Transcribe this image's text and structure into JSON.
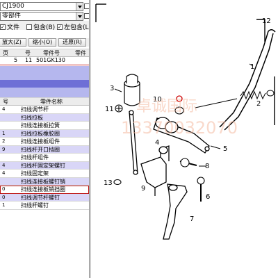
{
  "selectors": {
    "model_value": "CJ1900",
    "component_value": "零部件"
  },
  "options": {
    "opt1_label": "文件",
    "opt2_label": "包含(B)",
    "opt3_label": "左包含(L)"
  },
  "buttons": {
    "zoom_in": "放大(Z)",
    "zoom_out": "缩小(O)",
    "restore": "还原(R)"
  },
  "top_table": {
    "headers": [
      "页",
      "号",
      "零件号",
      "零件"
    ],
    "row": [
      "5",
      "11",
      "501GK130",
      ""
    ]
  },
  "parts_table": {
    "headers": [
      "号",
      "零件名称"
    ],
    "rows": [
      {
        "no": "4",
        "name": "扫线调节杆"
      },
      {
        "no": "",
        "name": "扫线拉板"
      },
      {
        "no": "",
        "name": "扫线连接板拉簧"
      },
      {
        "no": "1",
        "name": "扫线拉板橡胶圈"
      },
      {
        "no": "2",
        "name": "扫线连接板组件"
      },
      {
        "no": "9",
        "name": "扫线杆开口挡圈"
      },
      {
        "no": "",
        "name": "扫线杆组件"
      },
      {
        "no": "4",
        "name": "扫线杆固定架螺钉"
      },
      {
        "no": "4",
        "name": "扫线固定架"
      },
      {
        "no": "",
        "name": "扫线连接板螺钉销"
      },
      {
        "no": "0",
        "name": "扫线连接板销挡圈"
      },
      {
        "no": "0",
        "name": "扫线调节杆螺钉"
      },
      {
        "no": "1",
        "name": "扫线杆螺钉"
      }
    ],
    "active_index": 10
  },
  "diagram": {
    "labels": [
      "12",
      "1",
      "2",
      "3",
      "4",
      "5",
      "6",
      "7",
      "8",
      "9",
      "10",
      "11",
      "13"
    ],
    "watermark_line1": "卓诚国际",
    "watermark_line2": "13370032070"
  }
}
